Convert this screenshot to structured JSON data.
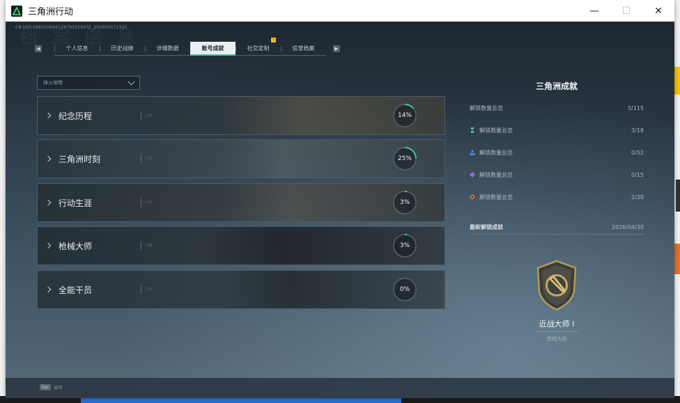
{
  "window": {
    "title": "三角洲行动",
    "controls": [
      "—",
      "☐",
      "✕"
    ]
  },
  "uid": "CN UID:18851084412879031907E_202605072325",
  "ghost_heading": "档 案 信 息",
  "tabs": [
    {
      "label": "个人信息"
    },
    {
      "label": "历史战绩"
    },
    {
      "label": "详细数据"
    },
    {
      "label": "账号成就",
      "active": true
    },
    {
      "label": "社交定制",
      "notif": "!"
    },
    {
      "label": "信誉档案"
    }
  ],
  "filter": {
    "value": "烽火地带"
  },
  "categories": [
    {
      "label": "纪念历程",
      "percent": 14,
      "percent_text": "14%",
      "muted": "/ 11"
    },
    {
      "label": "三角洲时刻",
      "percent": 25,
      "percent_text": "25%",
      "muted": "/ 11"
    },
    {
      "label": "行动生涯",
      "percent": 3,
      "percent_text": "3%",
      "muted": "/ 11"
    },
    {
      "label": "枪械大师",
      "percent": 3,
      "percent_text": "3%",
      "muted": "/ 11"
    },
    {
      "label": "全能干员",
      "percent": 0,
      "percent_text": "0%",
      "muted": "/ 11"
    }
  ],
  "summary": {
    "title": "三角洲成就",
    "total": {
      "label": "解锁数量总览",
      "value": "5/115"
    },
    "tiers": [
      {
        "label": "解锁数量总览",
        "value": "3/18",
        "color": "#3fc99a",
        "icon": "green-tier-icon"
      },
      {
        "label": "解锁数量总览",
        "value": "0/52",
        "color": "#4a8fe0",
        "icon": "blue-tier-icon"
      },
      {
        "label": "解锁数量总览",
        "value": "0/15",
        "color": "#9b6ae0",
        "icon": "purple-tier-icon"
      },
      {
        "label": "解锁数量总览",
        "value": "2/30",
        "color": "#e07a3a",
        "icon": "orange-tier-icon"
      }
    ],
    "latest_label": "最新解锁成就",
    "latest_date": "2026/04/30"
  },
  "latest_achievement": {
    "name": "近战大师 I",
    "category": "枪械大师"
  },
  "footer": {
    "key": "Esc",
    "label": "返回"
  },
  "colors": {
    "accent": "#37c9a0",
    "ring_track": "#56616b"
  }
}
